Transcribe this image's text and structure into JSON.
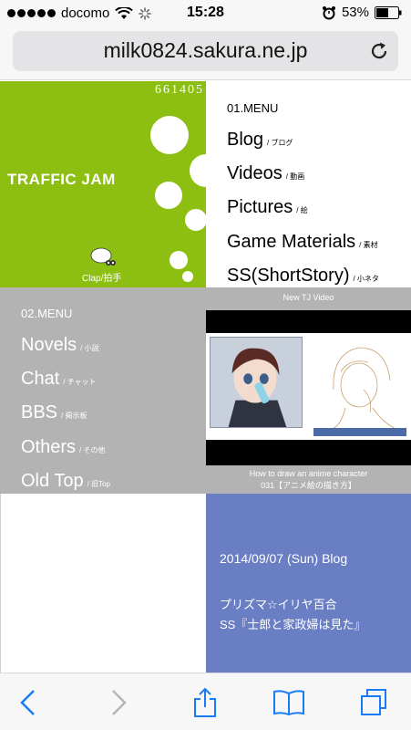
{
  "status_bar": {
    "carrier": "docomo",
    "time": "15:28",
    "battery": "53%"
  },
  "browser": {
    "url": "milk0824.sakura.ne.jp"
  },
  "header": {
    "counter": "661405",
    "title": "TRAFFIC JAM",
    "clap_label": "Clap/拍手"
  },
  "menu1": {
    "heading": "01.MENU",
    "items": [
      {
        "label": "Blog",
        "sub": "/ ブログ"
      },
      {
        "label": "Videos",
        "sub": "/ 動画"
      },
      {
        "label": "Pictures",
        "sub": "/ 絵"
      },
      {
        "label": "Game Materials",
        "sub": "/ 素材"
      },
      {
        "label": "SS(ShortStory)",
        "sub": "/ 小ネタ"
      }
    ]
  },
  "menu2": {
    "heading": "02.MENU",
    "items": [
      {
        "label": "Novels",
        "sub": "/ 小説"
      },
      {
        "label": "Chat",
        "sub": "/ チャット"
      },
      {
        "label": "BBS",
        "sub": "/ 掲示板"
      },
      {
        "label": "Others",
        "sub": "/ その他"
      },
      {
        "label": "Old Top",
        "sub": "/ 旧Top"
      }
    ]
  },
  "video": {
    "title": "New TJ Video",
    "caption_line1": "How to draw an anime character",
    "caption_line2": "031【アニメ絵の描き方】"
  },
  "blog": {
    "date": "2014/09/07 (Sun) Blog",
    "line1": "プリズマ☆イリヤ百合",
    "line2": "SS『士郎と家政婦は見た』"
  },
  "colors": {
    "green_panel": "#8cbf11",
    "gray_panel": "#b3b3b3",
    "blog_panel": "#6a7ec4",
    "ios_blue": "#1a7cf5"
  },
  "icons": [
    "wifi-icon",
    "activity-spinner-icon",
    "alarm-icon",
    "battery-icon",
    "reload-icon",
    "back-icon",
    "forward-icon",
    "share-icon",
    "bookmarks-icon",
    "tabs-icon"
  ]
}
